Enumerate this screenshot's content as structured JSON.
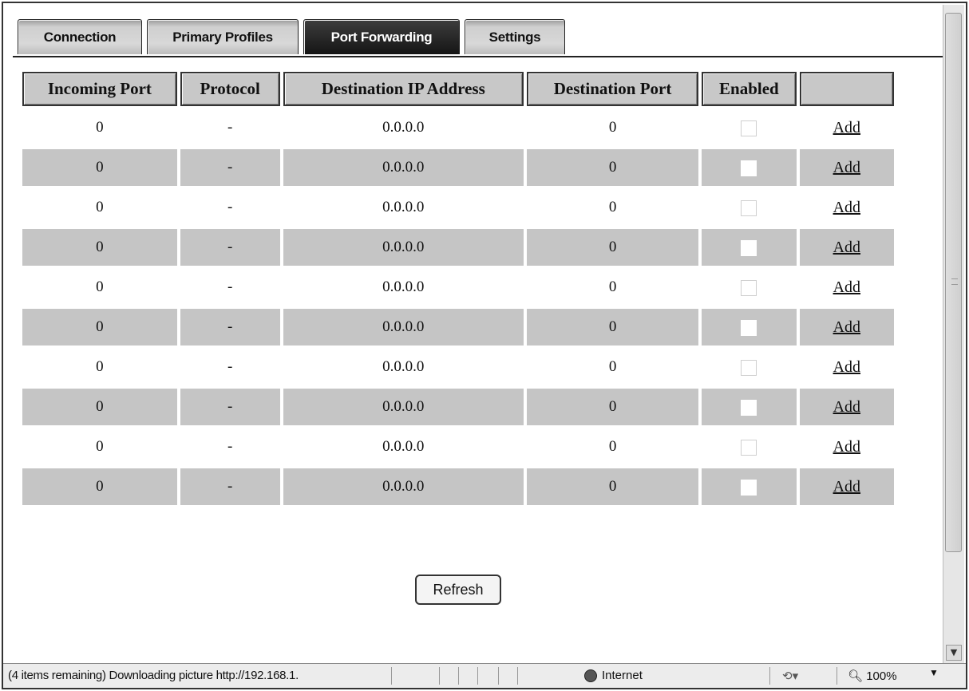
{
  "tabs": [
    {
      "label": "Connection",
      "active": false
    },
    {
      "label": "Primary Profiles",
      "active": false
    },
    {
      "label": "Port Forwarding",
      "active": true
    },
    {
      "label": "Settings",
      "active": false
    }
  ],
  "table": {
    "columns": [
      "Incoming Port",
      "Protocol",
      "Destination IP Address",
      "Destination Port",
      "Enabled",
      ""
    ],
    "rows": [
      {
        "incoming_port": "0",
        "protocol": "-",
        "destination_ip": "0.0.0.0",
        "destination_port": "0",
        "enabled": false,
        "action": "Add"
      },
      {
        "incoming_port": "0",
        "protocol": "-",
        "destination_ip": "0.0.0.0",
        "destination_port": "0",
        "enabled": false,
        "action": "Add"
      },
      {
        "incoming_port": "0",
        "protocol": "-",
        "destination_ip": "0.0.0.0",
        "destination_port": "0",
        "enabled": false,
        "action": "Add"
      },
      {
        "incoming_port": "0",
        "protocol": "-",
        "destination_ip": "0.0.0.0",
        "destination_port": "0",
        "enabled": false,
        "action": "Add"
      },
      {
        "incoming_port": "0",
        "protocol": "-",
        "destination_ip": "0.0.0.0",
        "destination_port": "0",
        "enabled": false,
        "action": "Add"
      },
      {
        "incoming_port": "0",
        "protocol": "-",
        "destination_ip": "0.0.0.0",
        "destination_port": "0",
        "enabled": false,
        "action": "Add"
      },
      {
        "incoming_port": "0",
        "protocol": "-",
        "destination_ip": "0.0.0.0",
        "destination_port": "0",
        "enabled": false,
        "action": "Add"
      },
      {
        "incoming_port": "0",
        "protocol": "-",
        "destination_ip": "0.0.0.0",
        "destination_port": "0",
        "enabled": false,
        "action": "Add"
      },
      {
        "incoming_port": "0",
        "protocol": "-",
        "destination_ip": "0.0.0.0",
        "destination_port": "0",
        "enabled": false,
        "action": "Add"
      },
      {
        "incoming_port": "0",
        "protocol": "-",
        "destination_ip": "0.0.0.0",
        "destination_port": "0",
        "enabled": false,
        "action": "Add"
      }
    ]
  },
  "refresh_label": "Refresh",
  "statusbar": {
    "message": "(4 items remaining) Downloading picture http://192.168.1.",
    "zone": "Internet",
    "zone_icon": "globe-icon",
    "zoom": "100%"
  },
  "colors": {
    "active_tab": "#1f1f1f",
    "shaded_row": "#c5c5c5",
    "header_bg": "#c8c8c8"
  }
}
